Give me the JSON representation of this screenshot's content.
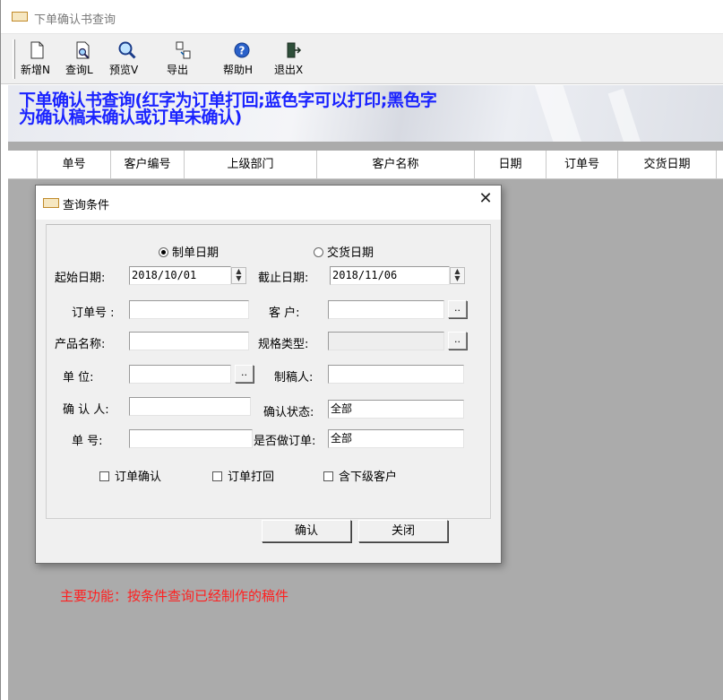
{
  "window": {
    "title": "下单确认书查询",
    "app_icon": "app-logo-icon"
  },
  "toolbar": {
    "buttons": [
      {
        "label": "新增N",
        "icon": "new-document-icon"
      },
      {
        "label": "查询L",
        "icon": "query-document-icon"
      },
      {
        "label": "预览V",
        "icon": "magnifier-preview-icon"
      },
      {
        "label": "导出",
        "icon": "export-icon"
      },
      {
        "label": "帮助H",
        "icon": "help-icon"
      },
      {
        "label": "退出X",
        "icon": "exit-door-icon"
      }
    ]
  },
  "banner": {
    "text_line1": "下单确认书查询(红字为订单打回;蓝色字可以打印;黑色字",
    "text_line2": "为确认稿未确认或订单未确认)",
    "color": "#1a23ff"
  },
  "grid": {
    "columns": [
      "单号",
      "客户编号",
      "上级部门",
      "客户名称",
      "日期",
      "订单号",
      "交货日期"
    ]
  },
  "dialog": {
    "title": "查询条件",
    "close_glyph": "✕",
    "radio_make_date": "制单日期",
    "radio_delivery_date": "交货日期",
    "date_type_selected": "制单日期",
    "start_date_label": "起始日期:",
    "start_date_value": "2018/10/01",
    "end_date_label": "截止日期:",
    "end_date_value": "2018/11/06",
    "order_no_label": "订单号 :",
    "order_no_value": "",
    "customer_label": "客  户:",
    "customer_value": "",
    "product_name_label": "产品名称:",
    "product_name_value": "",
    "spec_type_label": "规格类型:",
    "spec_type_value": "",
    "unit_label": "单  位:",
    "unit_value": "",
    "draft_maker_label": "制稿人:",
    "draft_maker_value": "",
    "confirmer_label": "确 认 人:",
    "confirmer_value": "",
    "confirm_status_label": "确认状态:",
    "confirm_status_value": "全部",
    "doc_no_label": "单  号:",
    "doc_no_value": "",
    "is_order_label": "是否做订单:",
    "is_order_value": "全部",
    "check_order_confirm": "订单确认",
    "check_order_return": "订单打回",
    "check_sub_customers": "含下级客户",
    "browse_glyph": "..",
    "confirm_button": "确认",
    "close_button": "关闭"
  },
  "footnote": {
    "text": "主要功能：按条件查询已经制作的稿件",
    "color": "#ff2020"
  }
}
